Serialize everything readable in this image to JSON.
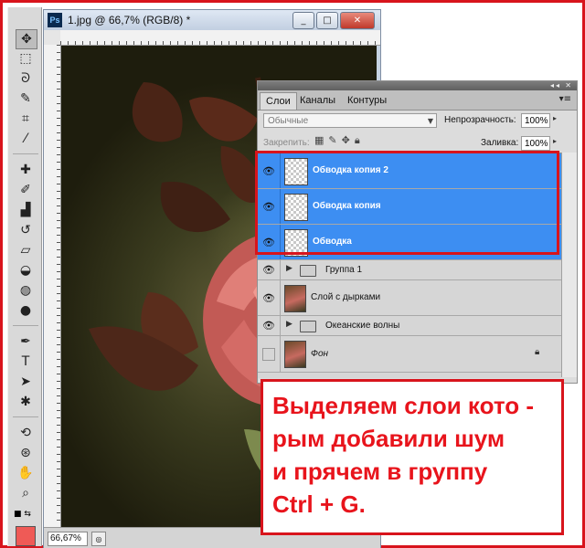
{
  "document": {
    "app_badge": "Ps",
    "title": "1.jpg @ 66,7% (RGB/8) *",
    "window_buttons": [
      "_",
      "□",
      "✕"
    ],
    "zoom": "66,67%"
  },
  "tools": {
    "items": [
      "move-tool",
      "marquee-tool",
      "lasso-tool",
      "quick-selection-tool",
      "crop-tool",
      "eyedropper-tool",
      "spot-healing-tool",
      "brush-tool",
      "clone-stamp-tool",
      "history-brush-tool",
      "eraser-tool",
      "paint-bucket-tool",
      "blur-tool",
      "dodge-tool",
      "pen-tool",
      "type-tool",
      "path-selection-tool",
      "shape-tool",
      "3d-rotate-tool",
      "3d-orbit-tool",
      "hand-tool",
      "zoom-tool"
    ],
    "foreground_color": "#ef5a56"
  },
  "layers_panel": {
    "tabs": [
      "Слои",
      "Каналы",
      "Контуры"
    ],
    "active_tab": "Слои",
    "blend_mode": "Обычные",
    "opacity_label": "Непрозрачность:",
    "opacity_value": "100%",
    "lock_label": "Закрепить:",
    "fill_label": "Заливка:",
    "fill_value": "100%",
    "layers": [
      {
        "name": "Обводка копия 2",
        "visible": true,
        "selected": true,
        "kind": "layer"
      },
      {
        "name": "Обводка копия",
        "visible": true,
        "selected": true,
        "kind": "layer"
      },
      {
        "name": "Обводка",
        "visible": true,
        "selected": true,
        "kind": "layer"
      },
      {
        "name": "Группа 1",
        "visible": true,
        "selected": false,
        "kind": "group"
      },
      {
        "name": "Слой с дырками",
        "visible": true,
        "selected": false,
        "kind": "layer"
      },
      {
        "name": "Океанские волны",
        "visible": true,
        "selected": false,
        "kind": "group"
      },
      {
        "name": "Фон",
        "visible": false,
        "selected": false,
        "kind": "background",
        "locked": true
      }
    ]
  },
  "annotation": {
    "lines": [
      "Выделяем слои кото -",
      "рым добавили шум",
      "и прячем в группу",
      "Ctrl + G."
    ],
    "color": "#e8141c"
  },
  "colors": {
    "selection_blue": "#3d8ef2",
    "highlight_red": "#d8141c"
  }
}
